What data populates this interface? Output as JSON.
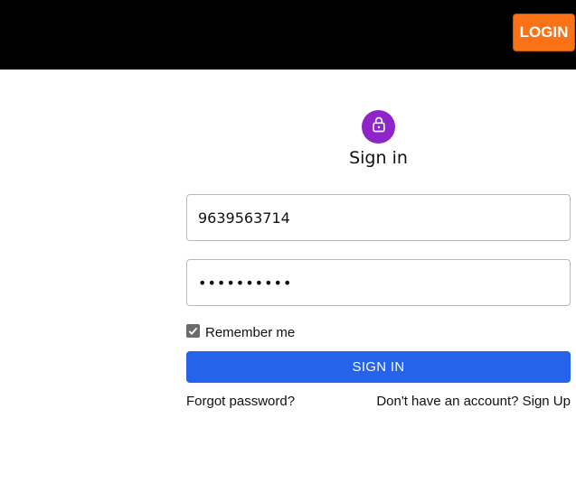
{
  "header": {
    "login_label": "LOGIN",
    "background": "#000000",
    "login_color": "#f97316"
  },
  "form": {
    "icon": "lock-icon",
    "icon_color": "#8e24c9",
    "title": "Sign in",
    "phone_value": "9639563714",
    "password_value": "••••••••••",
    "remember_label": "Remember me",
    "remember_checked": true,
    "submit_label": "SIGN IN",
    "submit_color": "#2563eb",
    "forgot_label": "Forgot password?",
    "signup_label": "Don't have an account? Sign Up"
  }
}
